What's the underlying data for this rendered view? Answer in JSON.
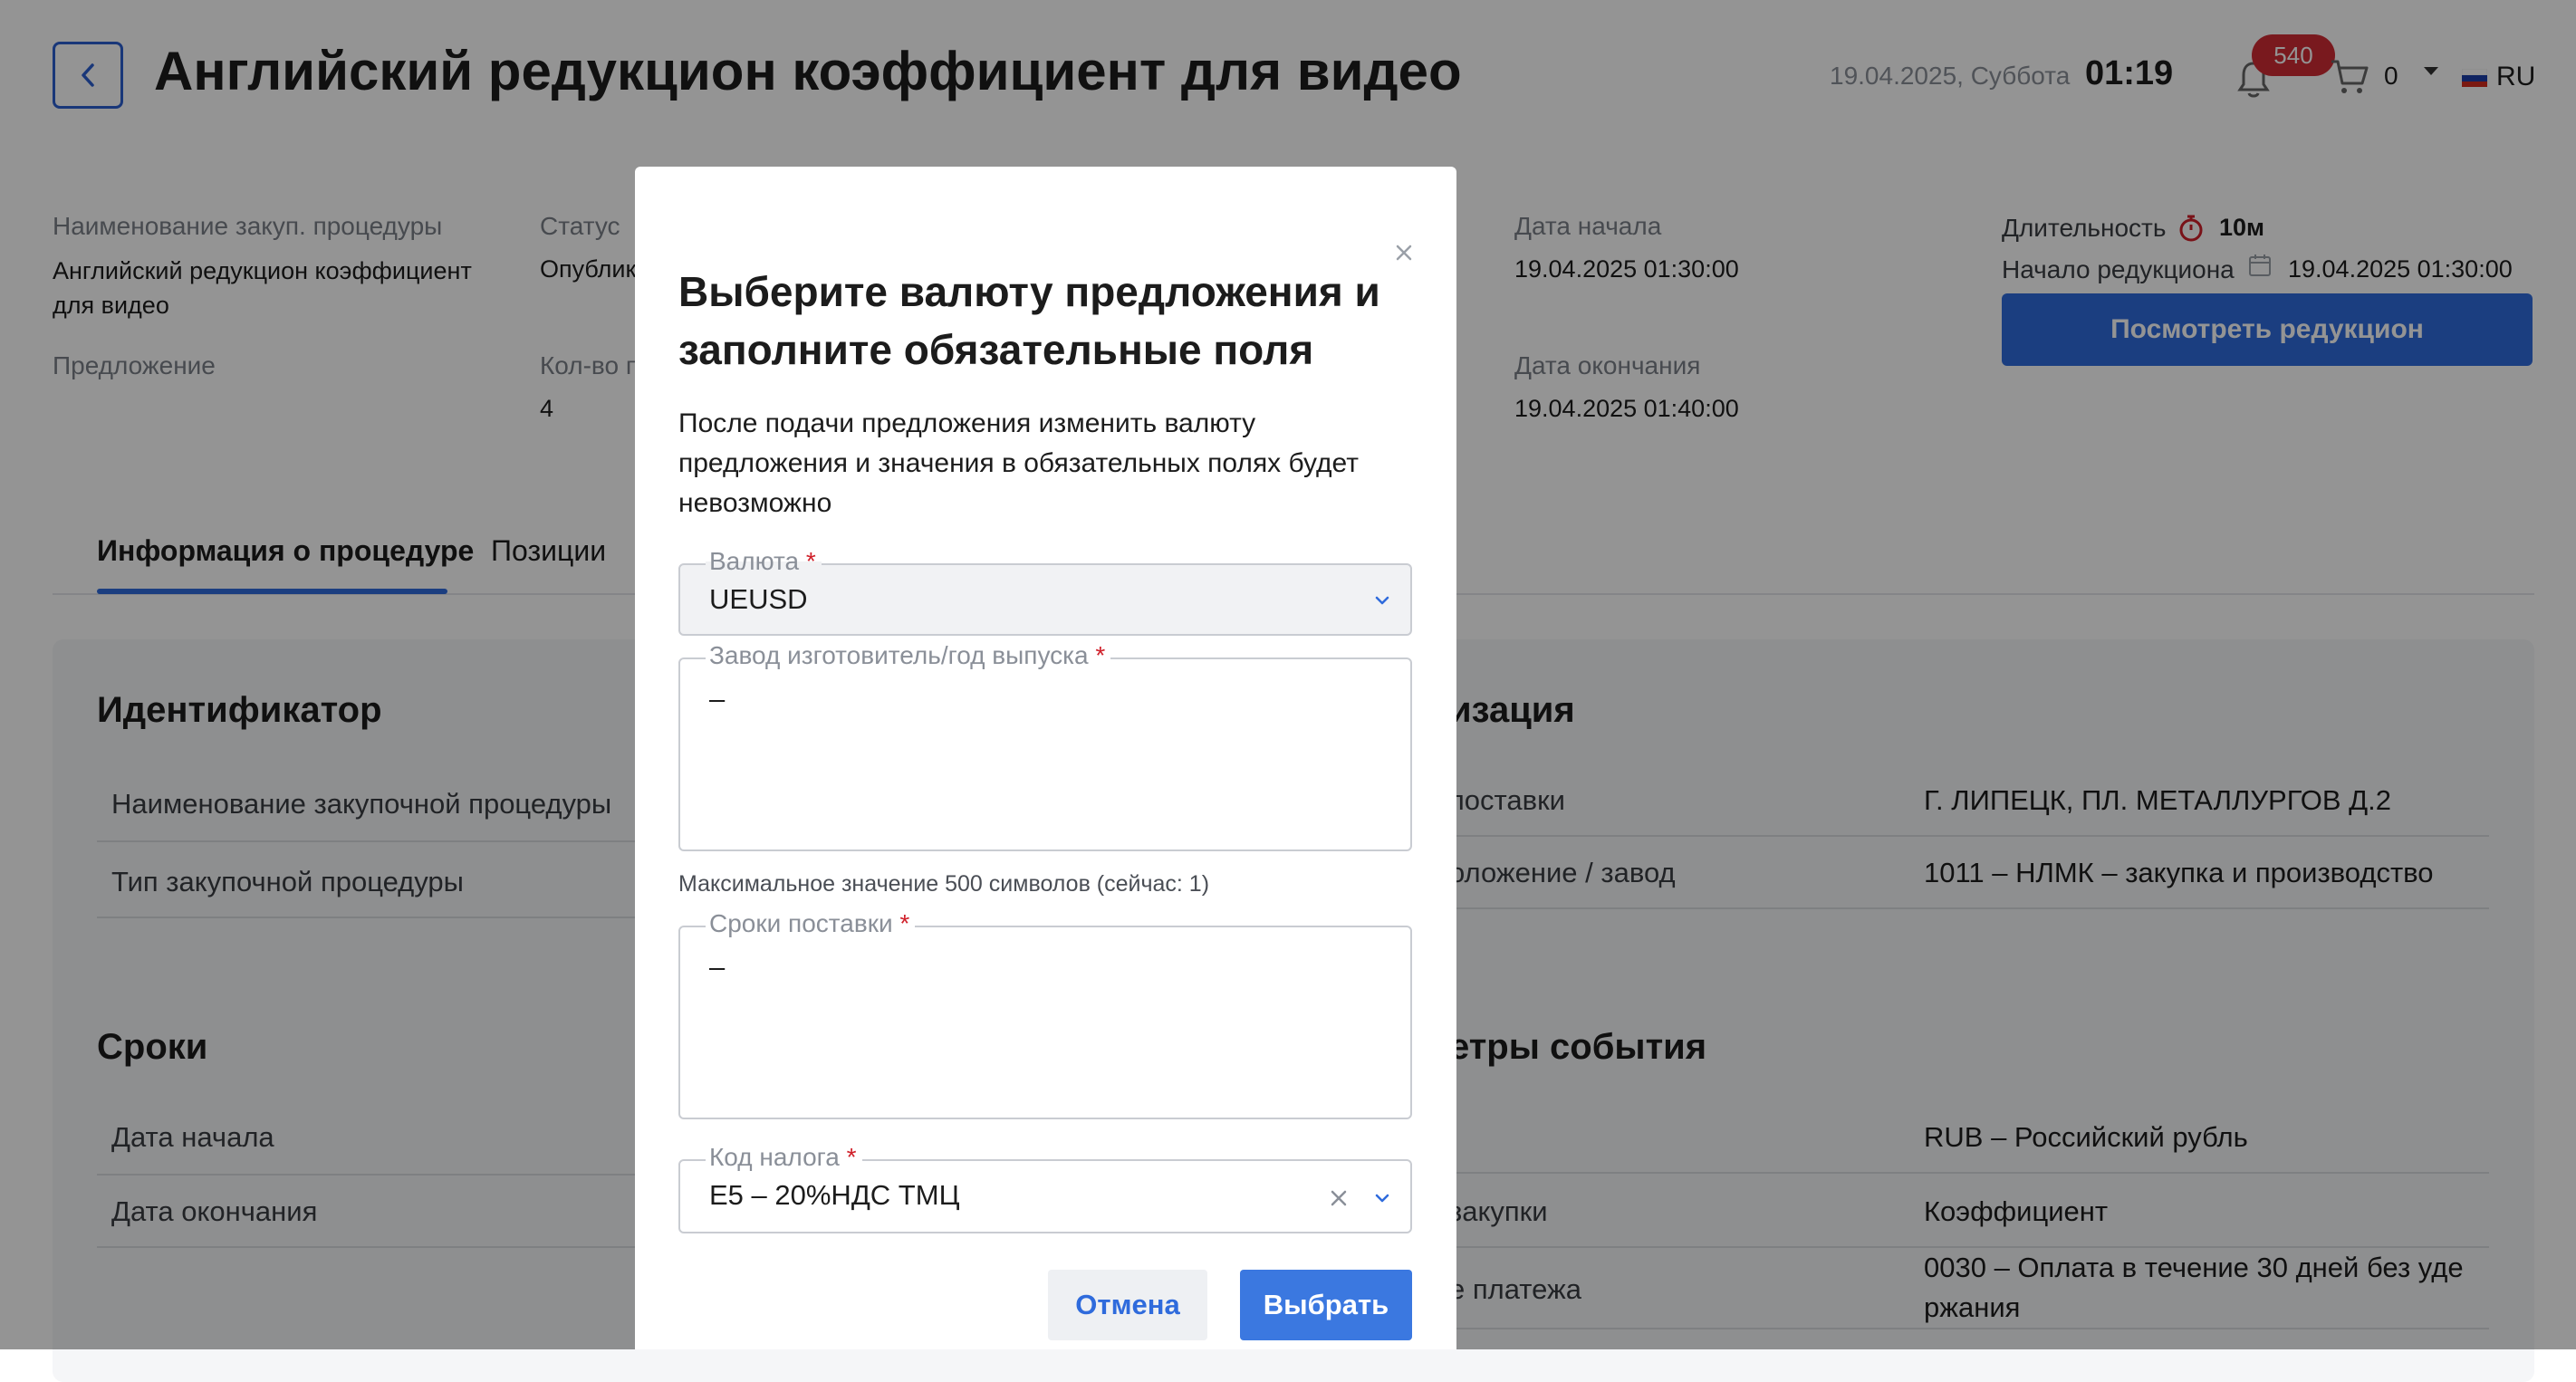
{
  "header": {
    "title": "Английский редукцион коэффициент для видео",
    "date": "19.04.2025, Суббота",
    "time": "01:19",
    "notifications_count": "540",
    "cart_count": "0",
    "language": "RU"
  },
  "summary": {
    "procedure_name_label": "Наименование закуп. процедуры",
    "procedure_name_value": "Английский редукцион коэффициент для видео",
    "status_label": "Статус",
    "status_value": "Опублик",
    "offer_label": "Предложение",
    "qty_label": "Кол-во п",
    "qty_value": "4",
    "start_label": "Дата начала",
    "start_value": "19.04.2025 01:30:00",
    "end_label": "Дата окончания",
    "end_value": "19.04.2025 01:40:00",
    "duration_label": "Длительность",
    "duration_value": "10м",
    "reduction_start_label": "Начало редукциона",
    "reduction_start_value": "19.04.2025 01:30:00",
    "view_button": "Посмотреть редукцион"
  },
  "tabs": [
    {
      "label": "Информация о процедуре"
    },
    {
      "label": "Позиции"
    }
  ],
  "sections": {
    "identifier": {
      "title": "Идентификатор",
      "rows": [
        "Наименование закупочной процедуры",
        "Тип закупочной процедуры"
      ]
    },
    "organization": {
      "title": "изация",
      "rows": [
        {
          "label": "поставки",
          "value": "Г. ЛИПЕЦК, ПЛ. МЕТАЛЛУРГОВ Д.2"
        },
        {
          "label": "оложение / завод",
          "value": "1011 – НЛМК – закупка и производство"
        }
      ]
    },
    "terms": {
      "title": "Сроки",
      "rows": [
        "Дата начала",
        "Дата окончания"
      ]
    },
    "event_params": {
      "title": "етры события",
      "rows": [
        {
          "label": "",
          "value": "RUB – Российский рубль"
        },
        {
          "label": "закупки",
          "value": "Коэффициент"
        },
        {
          "label": "е платежа",
          "value_line1": "0030 – Оплата в течение 30 дней без уде",
          "value_line2": "ржания"
        }
      ]
    }
  },
  "modal": {
    "title": "Выберите валюту предложения и заполните обязательные поля",
    "description": "После подачи предложения изменить валюту предложения и значения в обязательных полях будет невозможно",
    "currency_label": "Валюта",
    "currency_value": "UEUSD",
    "manufacturer_label": "Завод изготовитель/год выпуска",
    "manufacturer_value": "–",
    "manufacturer_hint": "Максимальное значение 500 символов (сейчас: 1)",
    "delivery_label": "Сроки поставки",
    "delivery_value": "–",
    "tax_label": "Код налога",
    "tax_value": "E5 – 20%НДС ТМЦ",
    "required_mark": "*",
    "cancel_button": "Отмена",
    "select_button": "Выбрать"
  },
  "colors": {
    "accent": "#2f6bdc",
    "badge": "#d02b35",
    "required": "#d0202a"
  },
  "icons": [
    "back-arrow-icon",
    "bell-icon",
    "cart-icon",
    "chevron-down-icon",
    "russia-flag-icon",
    "stopwatch-icon",
    "calendar-icon",
    "close-icon",
    "clear-icon"
  ]
}
